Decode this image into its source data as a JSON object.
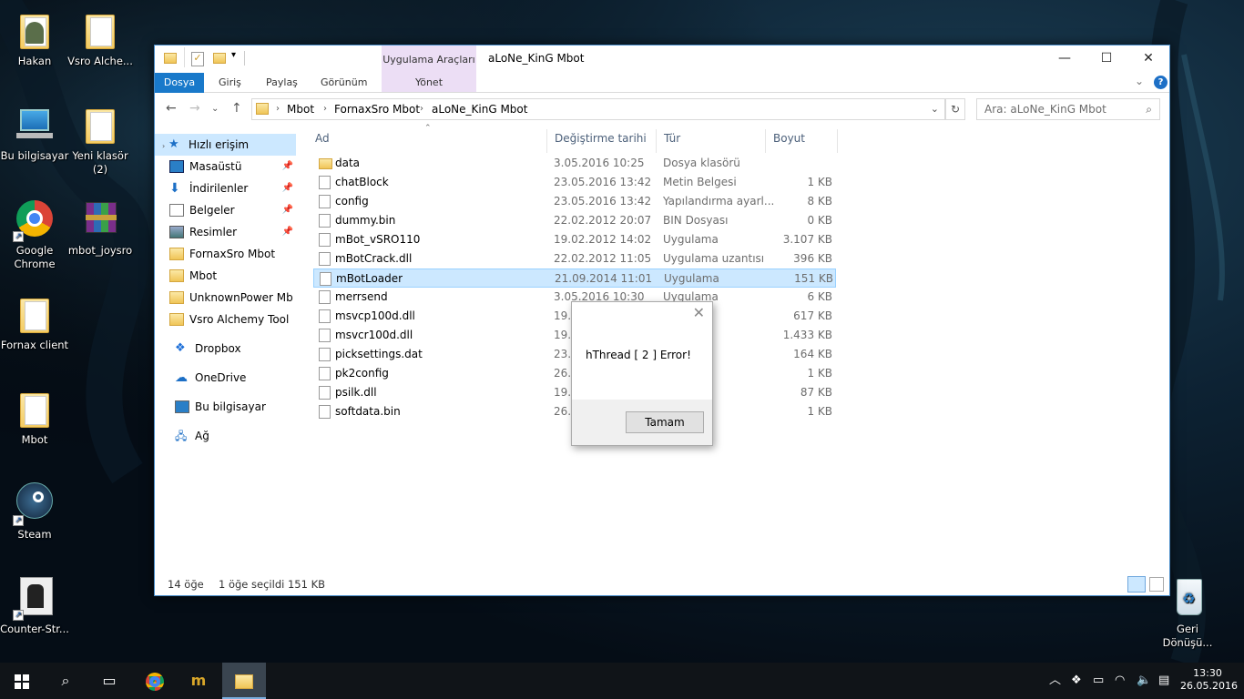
{
  "desktop": {
    "icons": [
      {
        "label": "Hakan",
        "type": "user"
      },
      {
        "label": "Vsro Alche...",
        "type": "folder"
      },
      {
        "label": "Bu bilgisayar",
        "type": "computer"
      },
      {
        "label": "Yeni klasör (2)",
        "type": "folder"
      },
      {
        "label": "Google Chrome",
        "type": "chrome"
      },
      {
        "label": "mbot_joysro",
        "type": "winrar"
      },
      {
        "label": "Fornax client",
        "type": "folder"
      },
      {
        "label": "Mbot",
        "type": "folder"
      },
      {
        "label": "Steam",
        "type": "steam"
      },
      {
        "label": "Counter-Str...",
        "type": "cs"
      },
      {
        "label": "Geri Dönüşü...",
        "type": "recycle"
      }
    ]
  },
  "window": {
    "title": "aLoNe_KinG Mbot",
    "context_tab": "Uygulama Araçları",
    "context_sub": "Yönet",
    "tabs": [
      "Dosya",
      "Giriş",
      "Paylaş",
      "Görünüm"
    ],
    "breadcrumb": [
      "Mbot",
      "FornaxSro Mbot",
      "aLoNe_KinG Mbot"
    ],
    "search_placeholder": "Ara: aLoNe_KinG Mbot",
    "columns": {
      "name": "Ad",
      "date": "Değiştirme tarihi",
      "type": "Tür",
      "size": "Boyut"
    },
    "sidebar": [
      {
        "label": "Hızlı erişim",
        "pinned": false
      },
      {
        "label": "Masaüstü",
        "pinned": true
      },
      {
        "label": "İndirilenler",
        "pinned": true
      },
      {
        "label": "Belgeler",
        "pinned": true
      },
      {
        "label": "Resimler",
        "pinned": true
      },
      {
        "label": "FornaxSro Mbot",
        "pinned": false
      },
      {
        "label": "Mbot",
        "pinned": false
      },
      {
        "label": "UnknownPower Mb",
        "pinned": false
      },
      {
        "label": "Vsro Alchemy Tool",
        "pinned": false
      },
      {
        "label": "Dropbox",
        "pinned": false
      },
      {
        "label": "OneDrive",
        "pinned": false
      },
      {
        "label": "Bu bilgisayar",
        "pinned": false
      },
      {
        "label": "Ağ",
        "pinned": false
      }
    ],
    "files": [
      {
        "name": "data",
        "date": "3.05.2016 10:25",
        "type": "Dosya klasörü",
        "size": ""
      },
      {
        "name": "chatBlock",
        "date": "23.05.2016 13:42",
        "type": "Metin Belgesi",
        "size": "1 KB"
      },
      {
        "name": "config",
        "date": "23.05.2016 13:42",
        "type": "Yapılandırma ayarl...",
        "size": "8 KB"
      },
      {
        "name": "dummy.bin",
        "date": "22.02.2012 20:07",
        "type": "BIN Dosyası",
        "size": "0 KB"
      },
      {
        "name": "mBot_vSRO110",
        "date": "19.02.2012 14:02",
        "type": "Uygulama",
        "size": "3.107 KB"
      },
      {
        "name": "mBotCrack.dll",
        "date": "22.02.2012 11:05",
        "type": "Uygulama uzantısı",
        "size": "396 KB"
      },
      {
        "name": "mBotLoader",
        "date": "21.09.2014 11:01",
        "type": "Uygulama",
        "size": "151 KB"
      },
      {
        "name": "merrsend",
        "date": "3.05.2016 10:30",
        "type": "Uygulama",
        "size": "6 KB"
      },
      {
        "name": "msvcp100d.dll",
        "date": "19.0",
        "type": "uzantısı",
        "size": "617 KB"
      },
      {
        "name": "msvcr100d.dll",
        "date": "19.0",
        "type": "uzantısı",
        "size": "1.433 KB"
      },
      {
        "name": "picksettings.dat",
        "date": "23.0",
        "type": "sı",
        "size": "164 KB"
      },
      {
        "name": "pk2config",
        "date": "26.0",
        "type": "a ayarl...",
        "size": "1 KB"
      },
      {
        "name": "psilk.dll",
        "date": "19.0",
        "type": "uzantısı",
        "size": "87 KB"
      },
      {
        "name": "softdata.bin",
        "date": "26.0",
        "type": "sı",
        "size": "1 KB"
      }
    ],
    "status_count": "14 öğe",
    "status_selected": "1 öğe seçildi  151 KB"
  },
  "dialog": {
    "message": "hThread [ 2 ] Error!",
    "ok": "Tamam"
  },
  "taskbar": {
    "time": "13:30",
    "date": "26.05.2016"
  }
}
